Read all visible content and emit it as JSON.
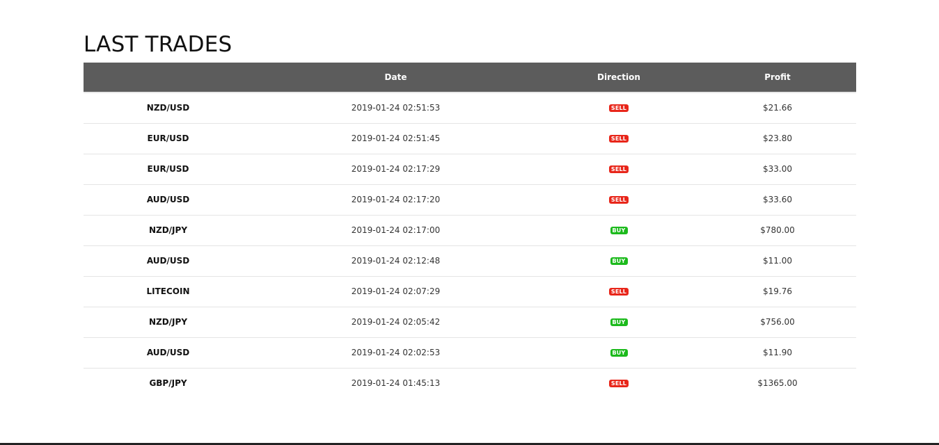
{
  "page": {
    "title": "LAST TRADES"
  },
  "table": {
    "headers": [
      "",
      "Date",
      "Direction",
      "Profit"
    ],
    "rows": [
      {
        "pair": "NZD/USD",
        "date": "2019-01-24 02:51:53",
        "direction": "SELL",
        "profit": "$21.66"
      },
      {
        "pair": "EUR/USD",
        "date": "2019-01-24 02:51:45",
        "direction": "SELL",
        "profit": "$23.80"
      },
      {
        "pair": "EUR/USD",
        "date": "2019-01-24 02:17:29",
        "direction": "SELL",
        "profit": "$33.00"
      },
      {
        "pair": "AUD/USD",
        "date": "2019-01-24 02:17:20",
        "direction": "SELL",
        "profit": "$33.60"
      },
      {
        "pair": "NZD/JPY",
        "date": "2019-01-24 02:17:00",
        "direction": "BUY",
        "profit": "$780.00"
      },
      {
        "pair": "AUD/USD",
        "date": "2019-01-24 02:12:48",
        "direction": "BUY",
        "profit": "$11.00"
      },
      {
        "pair": "LITECOIN",
        "date": "2019-01-24 02:07:29",
        "direction": "SELL",
        "profit": "$19.76"
      },
      {
        "pair": "NZD/JPY",
        "date": "2019-01-24 02:05:42",
        "direction": "BUY",
        "profit": "$756.00"
      },
      {
        "pair": "AUD/USD",
        "date": "2019-01-24 02:02:53",
        "direction": "BUY",
        "profit": "$11.90"
      },
      {
        "pair": "GBP/JPY",
        "date": "2019-01-24 01:45:13",
        "direction": "SELL",
        "profit": "$1365.00"
      }
    ]
  },
  "colors": {
    "header_bg": "#5c5c5c",
    "sell": "#e8261a",
    "buy": "#1cba1c"
  }
}
